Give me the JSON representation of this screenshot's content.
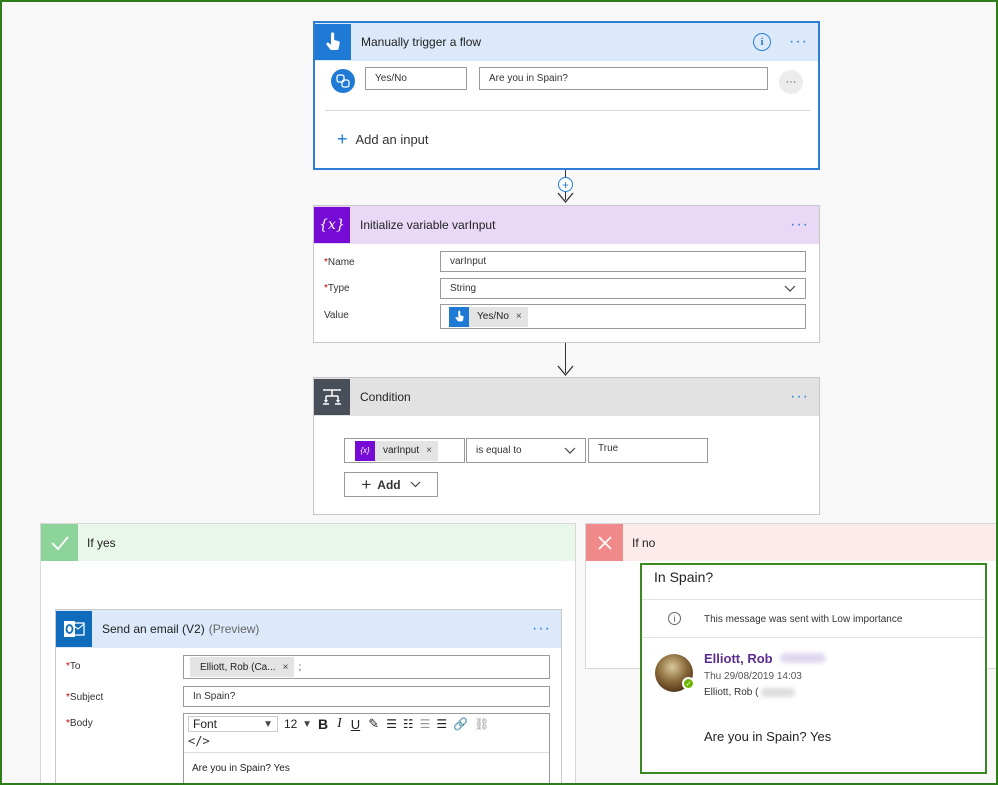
{
  "trigger": {
    "title": "Manually trigger a flow",
    "input_type": "Yes/No",
    "input_question": "Are you in Spain?",
    "add_input_label": "Add an input"
  },
  "init_variable": {
    "title": "Initialize variable varInput",
    "name_label": "Name",
    "name_value": "varInput",
    "type_label": "Type",
    "type_value": "String",
    "value_label": "Value",
    "value_token": "Yes/No"
  },
  "condition": {
    "title": "Condition",
    "left_token": "varInput",
    "operator": "is equal to",
    "right_value": "True",
    "add_label": "Add"
  },
  "if_yes": {
    "title": "If yes"
  },
  "if_no": {
    "title": "If no"
  },
  "send_email": {
    "title": "Send an email (V2)",
    "preview": "(Preview)",
    "to_label": "To",
    "to_token": "Elliott, Rob (Ca...",
    "to_sep": ";",
    "subject_label": "Subject",
    "subject_value": "In Spain?",
    "body_label": "Body",
    "font_select": "Font",
    "size_select": "12",
    "body_text": "Are you in Spain? Yes"
  },
  "email_preview": {
    "subject": "In Spain?",
    "importance_note": "This message was sent with Low importance",
    "sender_name": "Elliott, Rob",
    "datetime": "Thu 29/08/2019 14:03",
    "recipient": "Elliott, Rob (",
    "body": "Are you in Spain? Yes"
  },
  "colors": {
    "trigger_accent": "#1f7ad6",
    "variable_accent": "#770bd6",
    "condition_accent": "#484f58",
    "yes_accent": "#8cd49a",
    "no_accent": "#f08a8a",
    "outlook_blue": "#0f6cbd",
    "frame_green": "#2e7d1a"
  }
}
